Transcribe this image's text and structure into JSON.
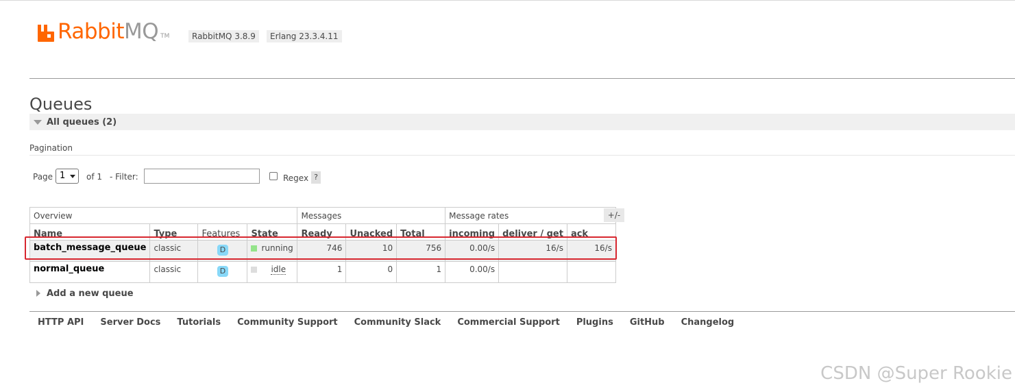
{
  "header": {
    "logo_rabbit": "Rabbit",
    "logo_mq": "MQ",
    "logo_tm": "TM",
    "rabbitmq_version": "RabbitMQ 3.8.9",
    "erlang_version": "Erlang 23.3.4.11"
  },
  "page": {
    "title": "Queues",
    "section_label": "All queues (2)"
  },
  "pagination": {
    "label": "Pagination",
    "page_label": "Page",
    "page_value": "1",
    "of_label": "of 1",
    "filter_label": "- Filter:",
    "filter_value": "",
    "regex_label": "Regex",
    "regex_checked": false,
    "help_label": "?"
  },
  "table": {
    "groups": [
      "Overview",
      "Messages",
      "Message rates"
    ],
    "columns_toggle": "+/-",
    "columns": [
      "Name",
      "Type",
      "Features",
      "State",
      "Ready",
      "Unacked",
      "Total",
      "incoming",
      "deliver / get",
      "ack"
    ],
    "rows": [
      {
        "name": "batch_message_queue",
        "type": "classic",
        "features": "D",
        "state": "running",
        "state_color": "#94e48a",
        "ready": "746",
        "unacked": "10",
        "total": "756",
        "incoming": "0.00/s",
        "deliver_get": "16/s",
        "ack": "16/s"
      },
      {
        "name": "normal_queue",
        "type": "classic",
        "features": "D",
        "state": "idle",
        "state_color": "#dddddd",
        "ready": "1",
        "unacked": "0",
        "total": "1",
        "incoming": "0.00/s",
        "deliver_get": "",
        "ack": ""
      }
    ]
  },
  "add_queue_label": "Add a new queue",
  "footer": {
    "links": [
      "HTTP API",
      "Server Docs",
      "Tutorials",
      "Community Support",
      "Community Slack",
      "Commercial Support",
      "Plugins",
      "GitHub",
      "Changelog"
    ]
  },
  "watermark": "CSDN @Super Rookie",
  "colors": {
    "brand_orange": "#ff6600",
    "highlight_red": "#d7262f",
    "feature_badge": "#88d8f8"
  }
}
